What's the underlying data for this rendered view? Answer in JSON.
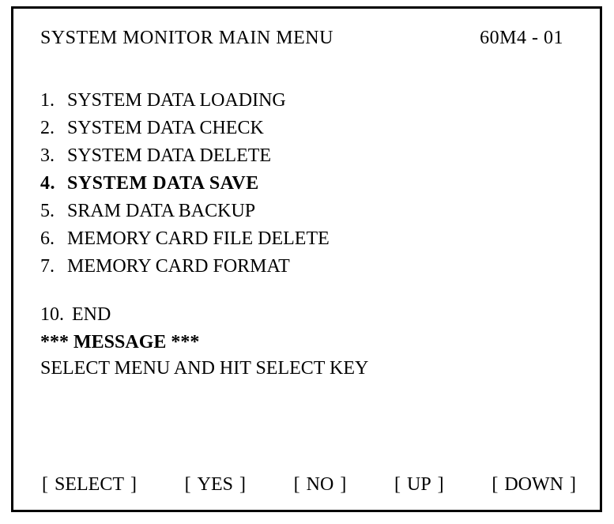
{
  "header": {
    "title": "SYSTEM MONITOR MAIN MENU",
    "screen_id": "60M4 - 01"
  },
  "menu": {
    "items": [
      {
        "num": "1.",
        "label": "SYSTEM DATA LOADING",
        "selected": false
      },
      {
        "num": "2.",
        "label": "SYSTEM DATA CHECK",
        "selected": false
      },
      {
        "num": "3.",
        "label": "SYSTEM DATA DELETE",
        "selected": false
      },
      {
        "num": "4.",
        "label": "SYSTEM DATA SAVE",
        "selected": true
      },
      {
        "num": "5.",
        "label": "SRAM DATA BACKUP",
        "selected": false
      },
      {
        "num": "6.",
        "label": "MEMORY CARD FILE DELETE",
        "selected": false
      },
      {
        "num": "7.",
        "label": "MEMORY CARD FORMAT",
        "selected": false
      }
    ],
    "end": {
      "num": "10.",
      "label": "END"
    }
  },
  "message": {
    "header": "*** MESSAGE ***",
    "text": "SELECT MENU AND HIT SELECT KEY"
  },
  "softkeys": {
    "select": "SELECT",
    "yes": "YES",
    "no": "NO",
    "up": "UP",
    "down": "DOWN"
  }
}
